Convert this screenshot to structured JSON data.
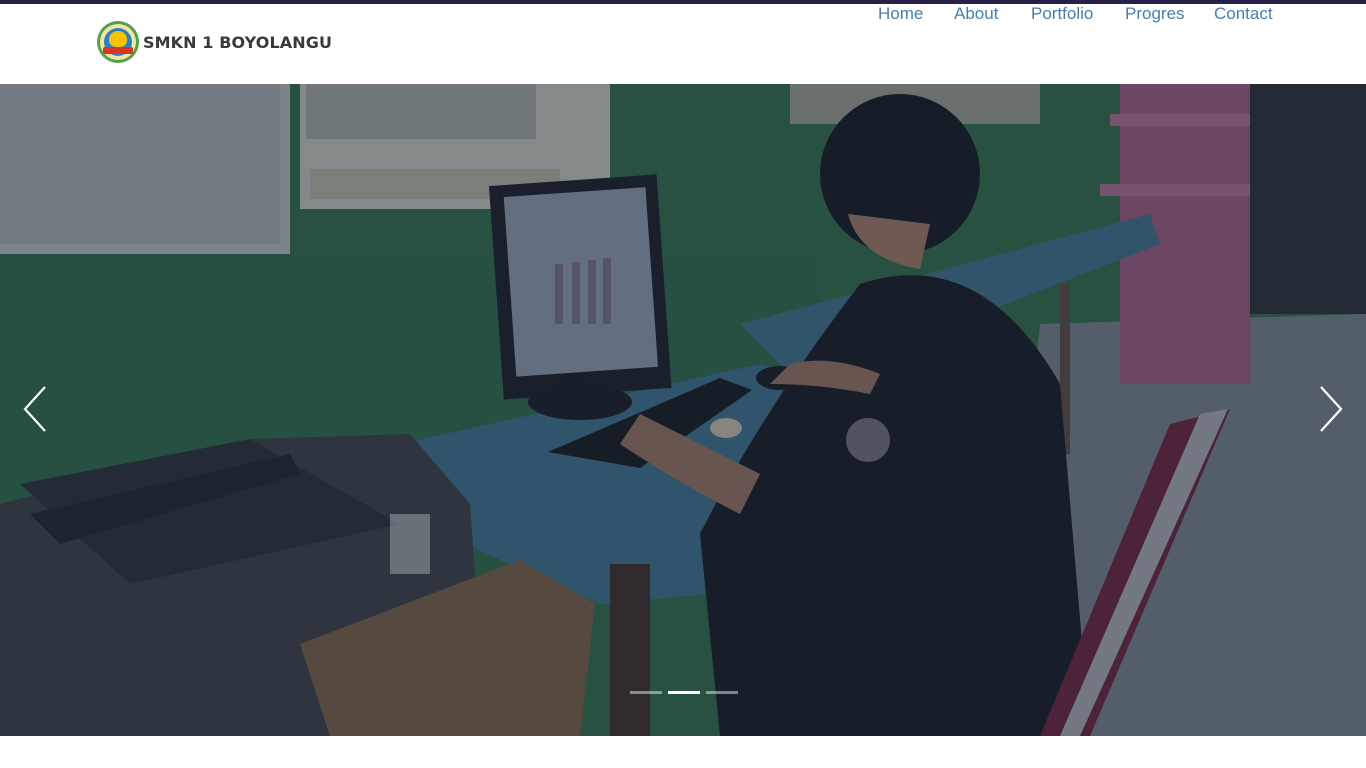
{
  "brand": {
    "name": "SMKN 1 BOYOLANGU",
    "logo_icon": "school-emblem-icon"
  },
  "nav": {
    "items": [
      {
        "label": "Home"
      },
      {
        "label": "About"
      },
      {
        "label": "Portfolio"
      },
      {
        "label": "Progres"
      },
      {
        "label": "Contact"
      }
    ]
  },
  "carousel": {
    "active_index": 1,
    "slide_count": 3,
    "slide_image_description_icon": "student-at-computer-photo",
    "controls": {
      "prev_icon": "chevron-left-icon",
      "next_icon": "chevron-right-icon"
    }
  },
  "colors": {
    "top_strip": "#27214a",
    "nav_link": "#4a7ea8",
    "brand_text": "#3a3a3a",
    "overlay": "#1e2a40"
  }
}
